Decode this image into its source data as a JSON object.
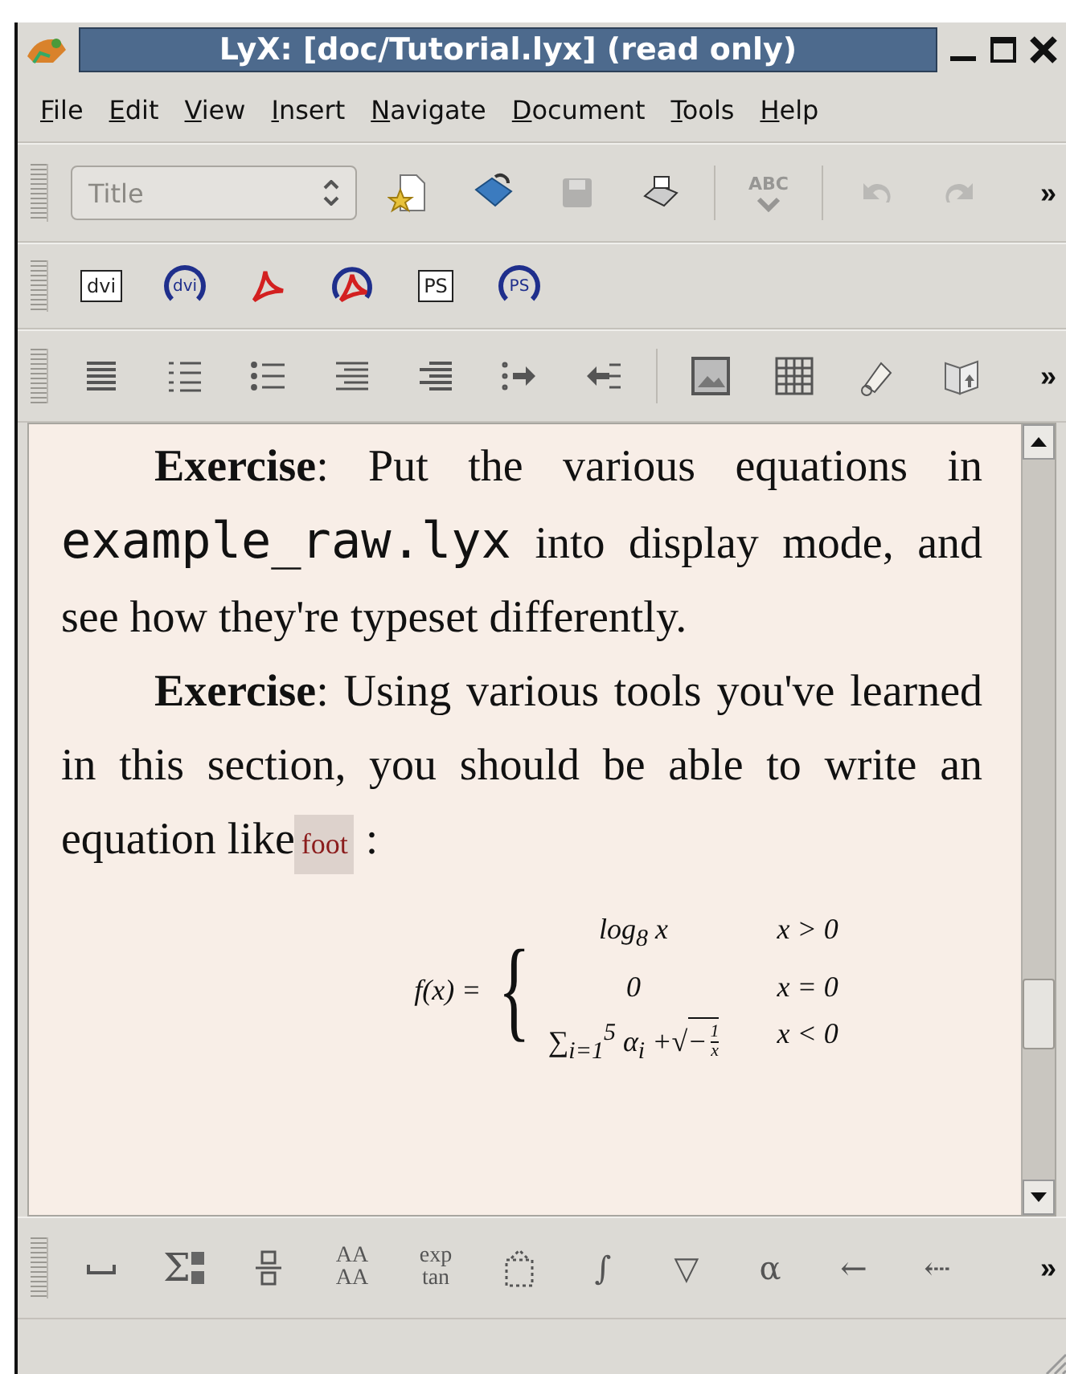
{
  "window": {
    "title": "LyX: [doc/Tutorial.lyx] (read only)"
  },
  "menu": [
    "File",
    "Edit",
    "View",
    "Insert",
    "Navigate",
    "Document",
    "Tools",
    "Help"
  ],
  "toolbars": [
    {
      "items": [
        {
          "kind": "combo",
          "placeholder": "Title"
        },
        {
          "kind": "new",
          "disabled": false
        },
        {
          "kind": "open",
          "disabled": false
        },
        {
          "kind": "save",
          "disabled": true
        },
        {
          "kind": "print",
          "disabled": false
        },
        {
          "kind": "sep"
        },
        {
          "kind": "spellcheck",
          "label": "ABC",
          "disabled": true
        },
        {
          "kind": "sep"
        },
        {
          "kind": "undo",
          "disabled": true
        },
        {
          "kind": "redo",
          "disabled": true
        },
        {
          "kind": "overflow",
          "label": "»"
        }
      ]
    },
    {
      "items": [
        {
          "kind": "boxed",
          "label": "dvi"
        },
        {
          "kind": "circled",
          "label": "dvi"
        },
        {
          "kind": "pdf"
        },
        {
          "kind": "pdf-circled"
        },
        {
          "kind": "boxed",
          "label": "PS"
        },
        {
          "kind": "circled",
          "label": "PS"
        }
      ]
    },
    {
      "items": [
        {
          "kind": "justify"
        },
        {
          "kind": "numbered-list"
        },
        {
          "kind": "bullet-list"
        },
        {
          "kind": "description"
        },
        {
          "kind": "list"
        },
        {
          "kind": "indent"
        },
        {
          "kind": "outdent"
        },
        {
          "kind": "sep"
        },
        {
          "kind": "image"
        },
        {
          "kind": "table"
        },
        {
          "kind": "note"
        },
        {
          "kind": "index"
        },
        {
          "kind": "overflow",
          "label": "»"
        }
      ]
    }
  ],
  "document": {
    "paragraphs": [
      {
        "segments": [
          {
            "kind": "bold",
            "text": "Exercise"
          },
          {
            "kind": "plain",
            "text": ": Put the various equations in "
          },
          {
            "kind": "mono",
            "text": "example_raw.lyx"
          },
          {
            "kind": "plain",
            "text": " into display mode, and see how they're typeset differently."
          }
        ]
      },
      {
        "segments": [
          {
            "kind": "bold",
            "text": "Exercise"
          },
          {
            "kind": "plain",
            "text": ": Using various tools you've learned in this section, you should be able to write an equation like"
          },
          {
            "kind": "inset",
            "text": "foot"
          },
          {
            "kind": "plain",
            "text": " :"
          }
        ]
      }
    ],
    "equation": {
      "lhs": "f(x) =",
      "brace": "{",
      "cases": [
        {
          "expr": "log$_{8}$ x",
          "cond": "x > 0"
        },
        {
          "expr": "0",
          "cond": "x = 0"
        },
        {
          "expr": "∑$_{i=1}$$^{5}$ α$_{i}$ +",
          "radicand": {
            "root": "√",
            "sign": "−",
            "num": "1",
            "den": "x"
          },
          "cond": "x < 0"
        }
      ]
    }
  },
  "math_toolbar": {
    "items": [
      {
        "kind": "space"
      },
      {
        "kind": "sum",
        "label": "Σ"
      },
      {
        "kind": "frac"
      },
      {
        "kind": "stack",
        "top": "AA",
        "bottom": "AA"
      },
      {
        "kind": "stack",
        "top": "exp",
        "bottom": "tan"
      },
      {
        "kind": "box"
      },
      {
        "kind": "glyph",
        "label": "∫"
      },
      {
        "kind": "glyph",
        "label": "▽"
      },
      {
        "kind": "glyph",
        "label": "α"
      },
      {
        "kind": "glyph",
        "label": "←"
      },
      {
        "kind": "glyph",
        "label": "⇠"
      },
      {
        "kind": "overflow",
        "label": "»"
      }
    ]
  }
}
